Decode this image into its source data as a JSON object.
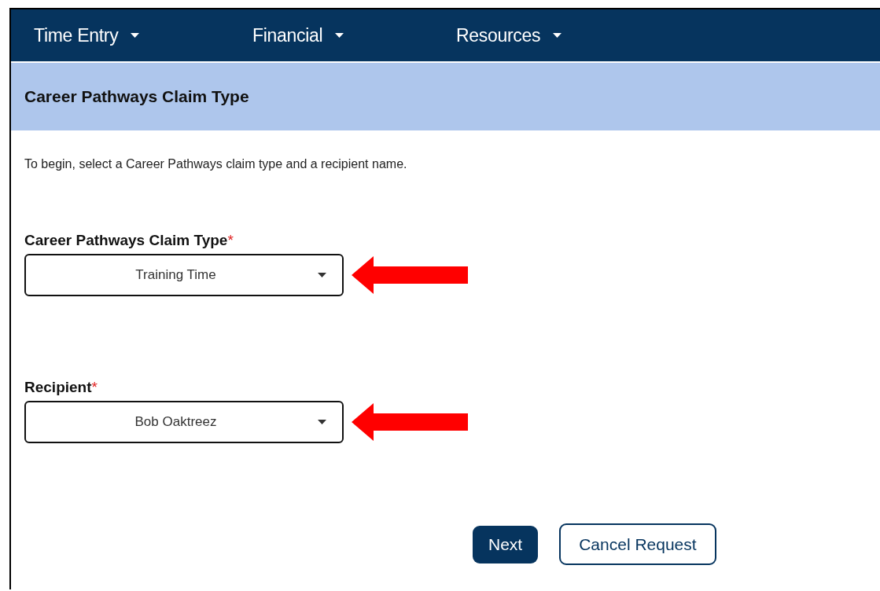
{
  "nav": {
    "items": [
      {
        "label": "Time Entry"
      },
      {
        "label": "Financial"
      },
      {
        "label": "Resources"
      }
    ]
  },
  "header": {
    "title": "Career Pathways Claim Type"
  },
  "intro": "To begin, select a Career Pathways claim type and a recipient name.",
  "fields": [
    {
      "label": "Career Pathways Claim Type",
      "required_mark": "*",
      "value": "Training Time",
      "highlighted": true
    },
    {
      "label": "Recipient",
      "required_mark": "*",
      "value": "Bob Oaktreez",
      "highlighted": true
    }
  ],
  "buttons": [
    {
      "label": "Next",
      "kind": "primary"
    },
    {
      "label": "Cancel Request",
      "kind": "secondary"
    }
  ]
}
